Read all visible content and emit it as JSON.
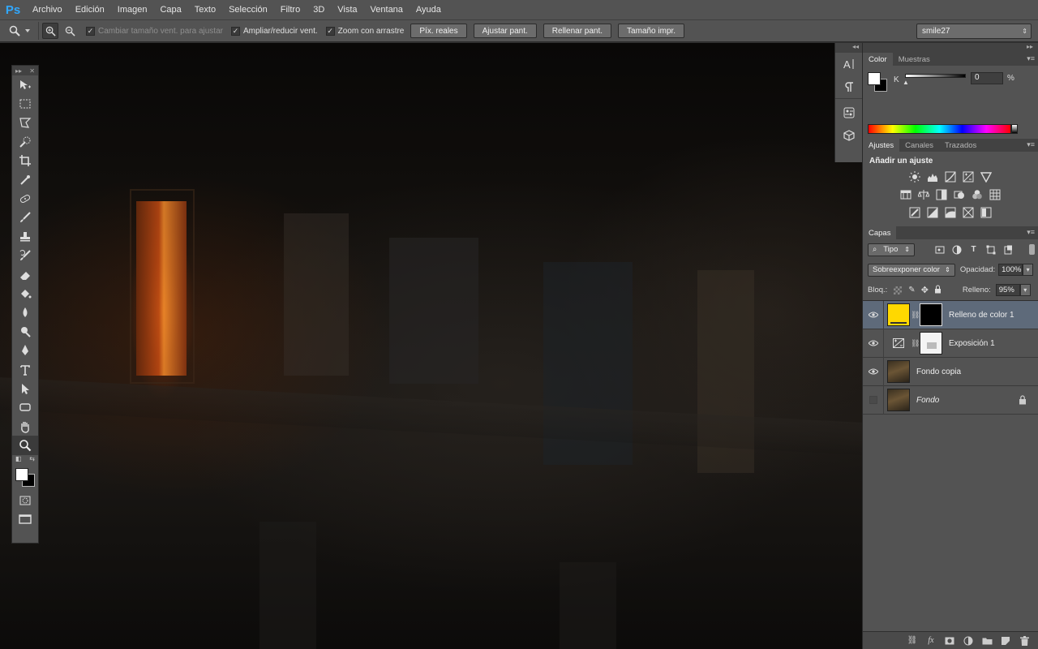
{
  "app": {
    "logo": "Ps"
  },
  "menu": [
    "Archivo",
    "Edición",
    "Imagen",
    "Capa",
    "Texto",
    "Selección",
    "Filtro",
    "3D",
    "Vista",
    "Ventana",
    "Ayuda"
  ],
  "options": {
    "resize_windows": "Cambiar tamaño vent. para ajustar",
    "zoom_all_windows": "Ampliar/reducir vent.",
    "scrubby_zoom": "Zoom con arrastre",
    "actual_pixels": "Píx. reales",
    "fit_screen": "Ajustar pant.",
    "fill_screen": "Rellenar pant.",
    "print_size": "Tamaño impr.",
    "workspace": "smile27"
  },
  "color_panel": {
    "tabs": [
      "Color",
      "Muestras"
    ],
    "k_label": "K",
    "k_value": "0",
    "k_unit": "%",
    "foreground": "#ffffff",
    "background": "#000000"
  },
  "adjustments_panel": {
    "tabs": [
      "Ajustes",
      "Canales",
      "Trazados"
    ],
    "title": "Añadir un ajuste"
  },
  "layers_panel": {
    "tab": "Capas",
    "filter_kind": "Tipo",
    "blend_mode": "Sobreexponer color",
    "opacity_label": "Opacidad:",
    "opacity": "100%",
    "lock_label": "Bloq.:",
    "fill_label": "Relleno:",
    "fill": "95%",
    "layers": [
      {
        "name": "Relleno de color 1",
        "visible": true,
        "selected": true,
        "type": "fill",
        "fill_color": "#ffd800"
      },
      {
        "name": "Exposición 1",
        "visible": true,
        "selected": false,
        "type": "adjustment"
      },
      {
        "name": "Fondo copia",
        "visible": true,
        "selected": false,
        "type": "image"
      },
      {
        "name": "Fondo",
        "visible": false,
        "selected": false,
        "type": "image",
        "locked": true
      }
    ],
    "bottom_icons": [
      "link-icon",
      "fx-icon",
      "mask-icon",
      "adjustment-icon",
      "group-icon",
      "new-layer-icon",
      "trash-icon"
    ]
  },
  "colors": {
    "ui_dark": "#535353",
    "selected_layer": "#5e6a7a",
    "accent": "#31a8ff"
  }
}
